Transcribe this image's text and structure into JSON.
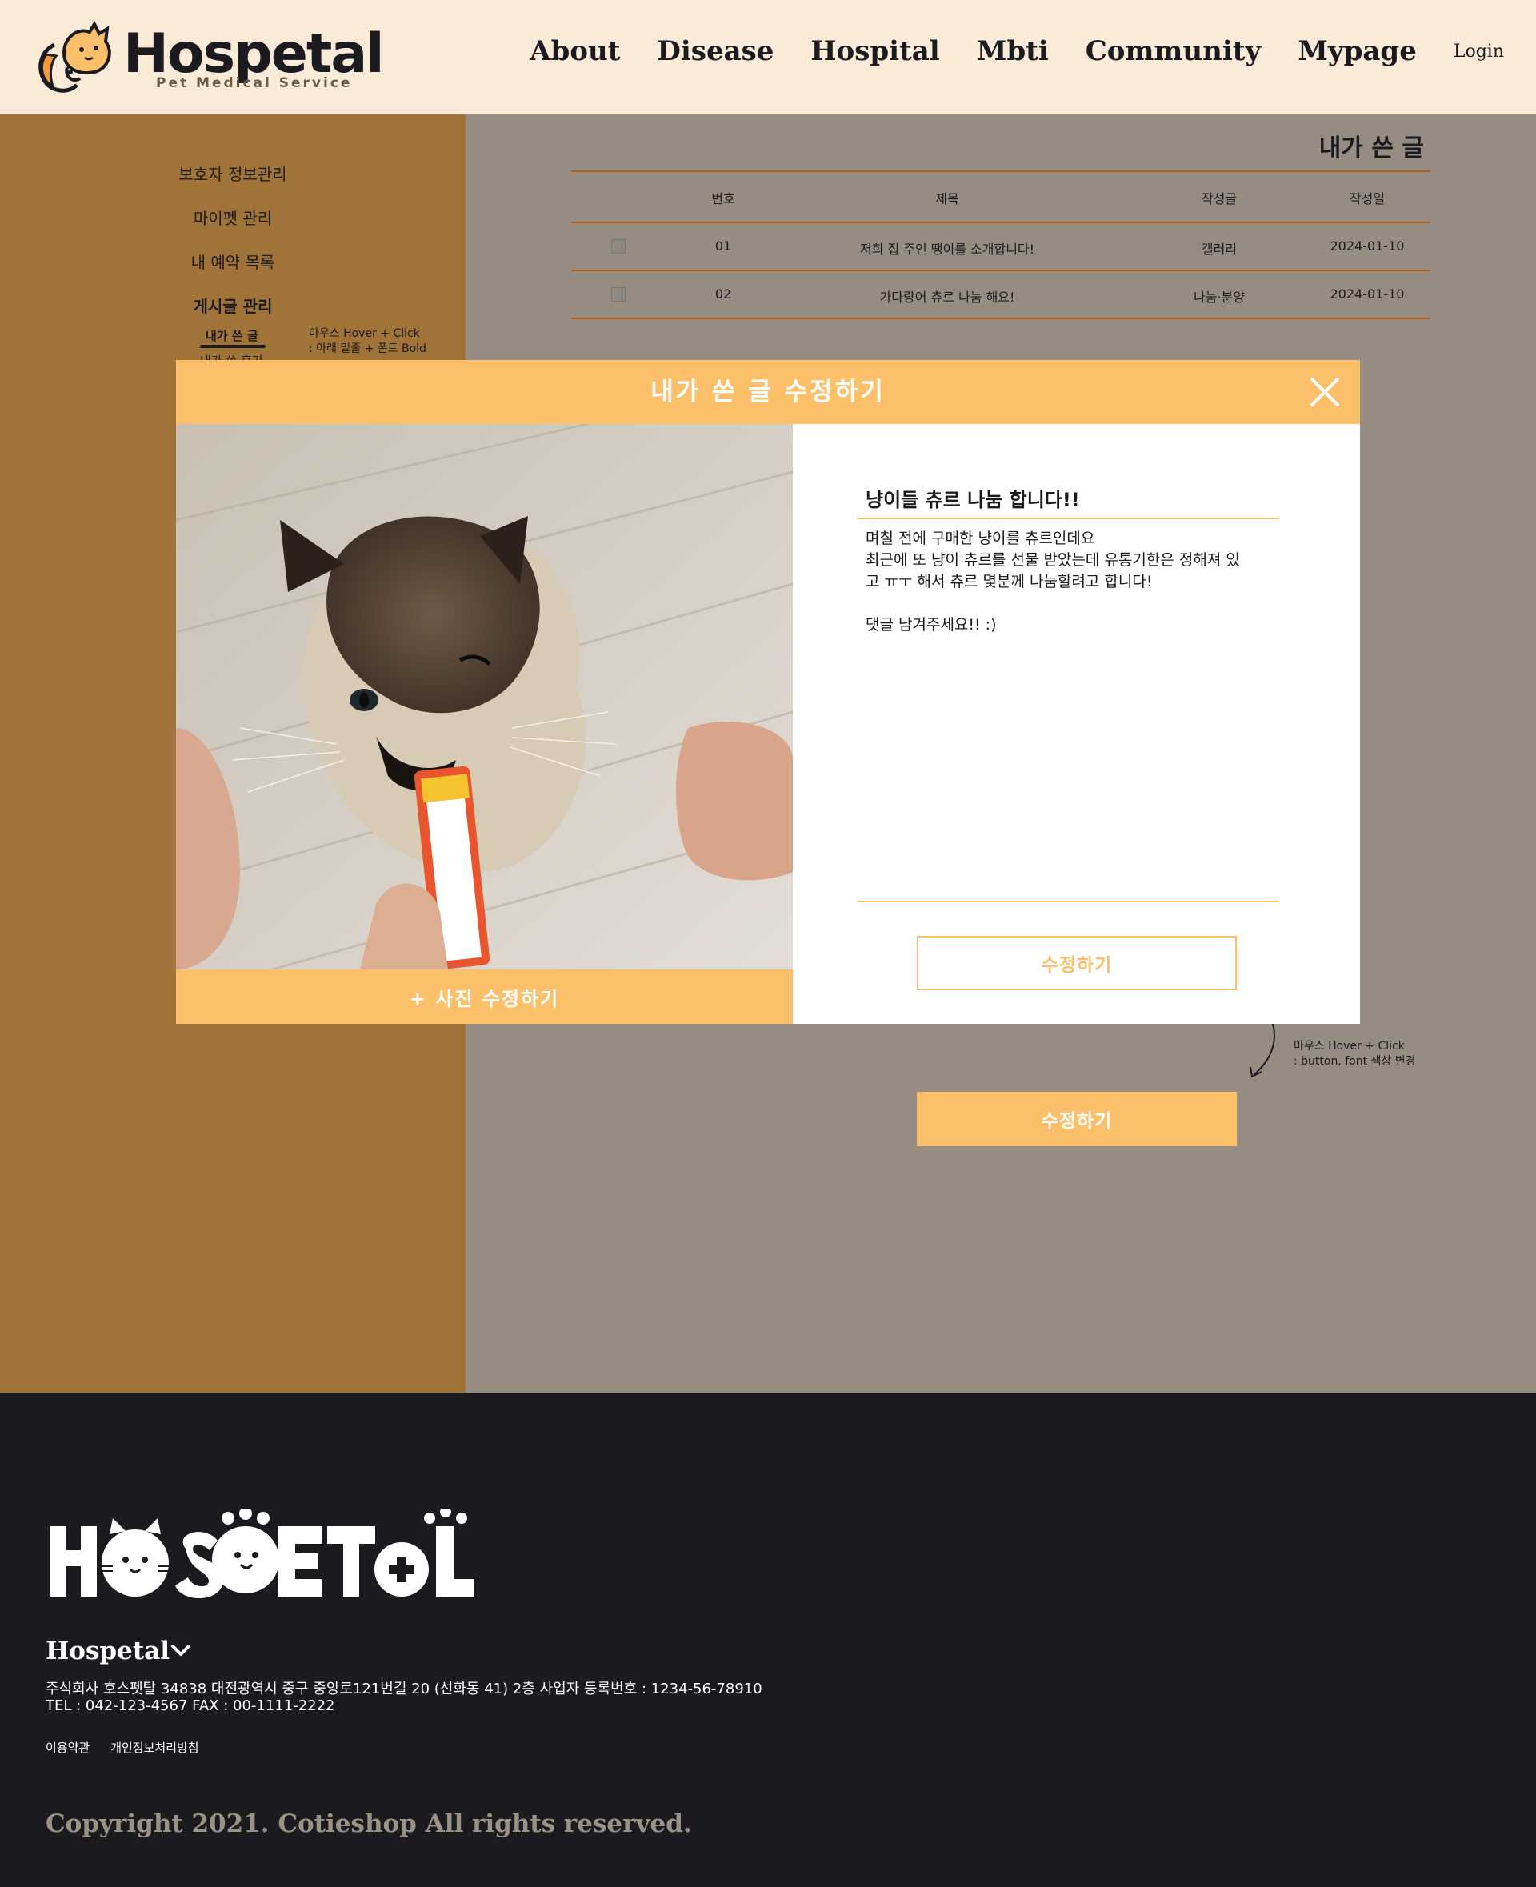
{
  "header": {
    "logo_title": "Hospetal",
    "logo_subtitle": "Pet Medical Service",
    "nav": [
      "About",
      "Disease",
      "Hospital",
      "Mbti",
      "Community",
      "Mypage"
    ],
    "login": "Login"
  },
  "sidebar": {
    "items": [
      "보호자 정보관리",
      "마이펫 관리",
      "내 예약 목록",
      "게시글 관리"
    ],
    "sub_items": [
      "내가 쓴 글",
      "내가 쓴 후기"
    ],
    "note": [
      "마우스 Hover + Click",
      ": 아래 밑줄 + 폰트 Bold"
    ]
  },
  "main": {
    "heading": "내가 쓴 글",
    "columns": [
      "번호",
      "제목",
      "작성글",
      "작성일"
    ],
    "rows": [
      {
        "no": "01",
        "title": "저희 집 주인 땡이를 소개합니다!",
        "category": "갤러리",
        "date": "2024-01-10"
      },
      {
        "no": "02",
        "title": "가다랑어 츄르 나눔 해요!",
        "category": "나눔·분양",
        "date": "2024-01-10"
      }
    ],
    "note": [
      "마우스 Hover + Click",
      ": button, font 색상 변경"
    ],
    "hover_button": "수정하기"
  },
  "modal": {
    "title": "내가 쓴 글 수정하기",
    "photo_button": "+ 사진 수정하기",
    "post_title": "냥이들 츄르 나눔 합니다!!",
    "post_body": "며칠 전에 구매한 냥이를 츄르인데요\n최근에 또 냥이 츄르를 선물 받았는데 유통기한은 정해져 있\n고 ㅠㅜ 해서 츄르 몇분께 나눔할려고 합니다!\n\n댓글 남겨주세요!! :)",
    "edit_button": "수정하기"
  },
  "footer": {
    "company": "Hospetal",
    "address": "주식회사 호스펫탈 34838 대전광역시 중구 중앙로121번길 20 (선화동 41) 2층  사업자 등록번호 : 1234-56-78910",
    "tel": "TEL : 042-123-4567 FAX : 00-1111-2222",
    "links": [
      "이용약관",
      "개인정보처리방침"
    ],
    "copyright": "Copyright 2021. Cotieshop All rights reserved."
  },
  "colors": {
    "accent": "#fdc06a",
    "header_bg": "#faebd8",
    "sidebar_dim": "#a07339",
    "main_dim": "#968c81",
    "footer_bg": "#1b1b1f",
    "table_line": "#b25e1a"
  }
}
